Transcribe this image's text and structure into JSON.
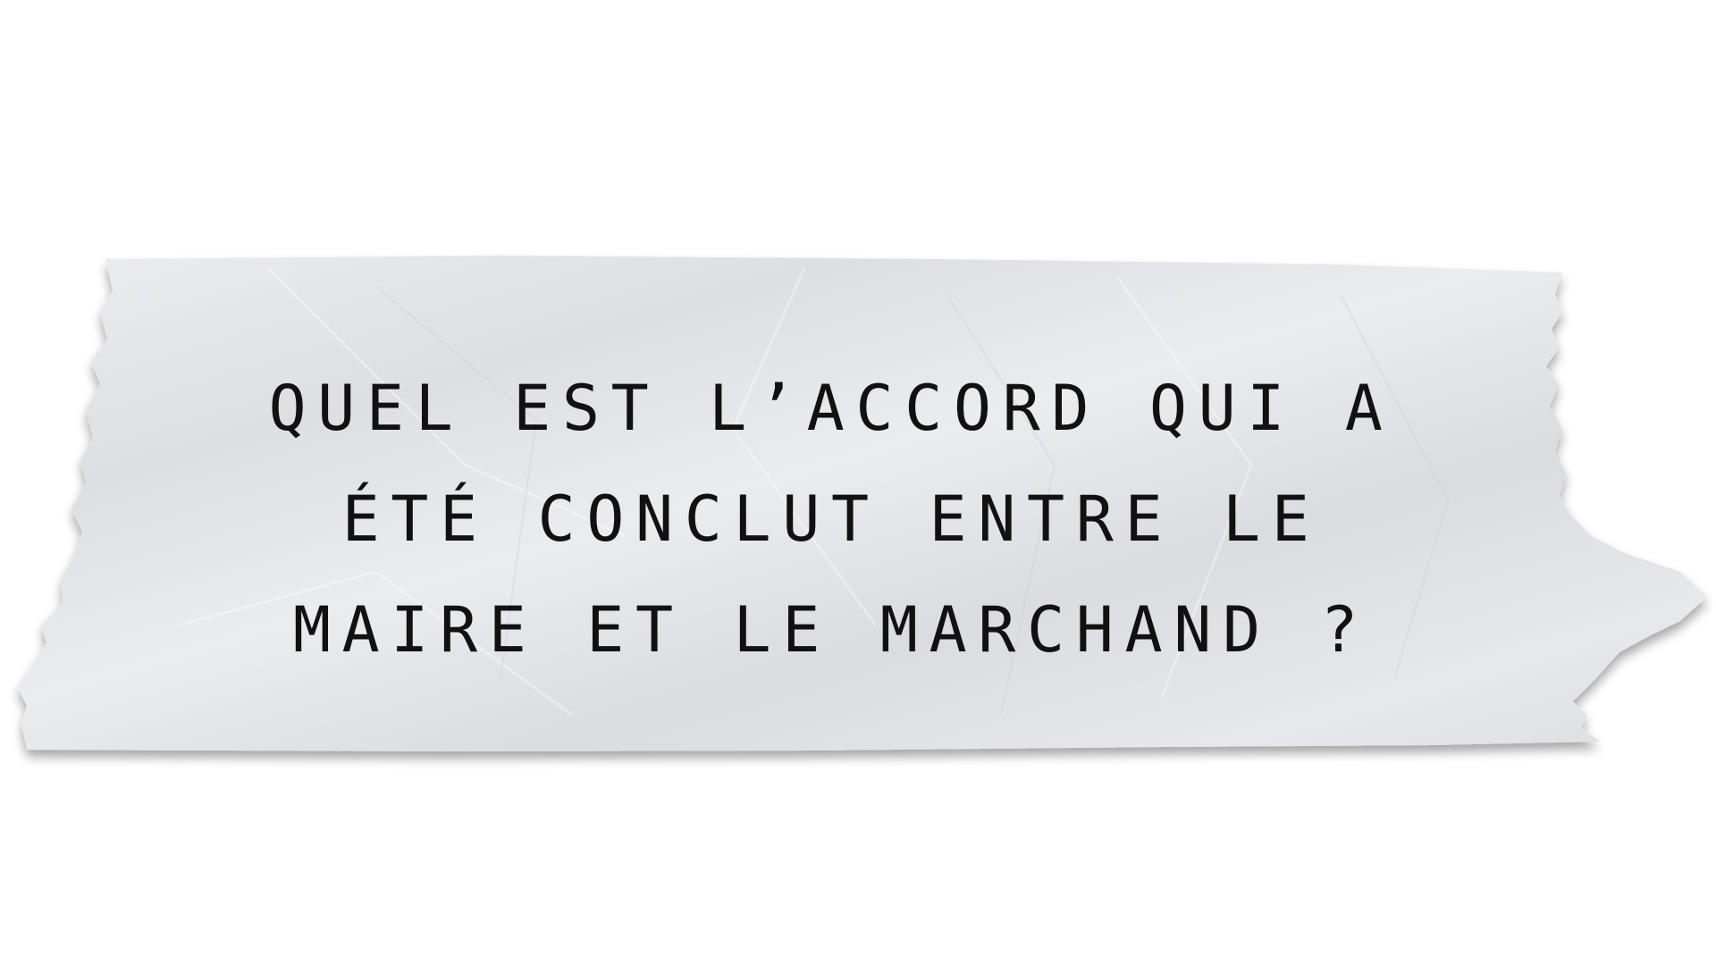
{
  "note": {
    "lines": [
      "QUEL EST L’ACCORD  QUI A",
      "ÉTÉ CONCLUT ENTRE LE",
      "MAIRE ET LE MARCHAND ?"
    ]
  },
  "colors": {
    "paper": "#e6e7ea",
    "ink": "#111111",
    "background": "#ffffff"
  }
}
